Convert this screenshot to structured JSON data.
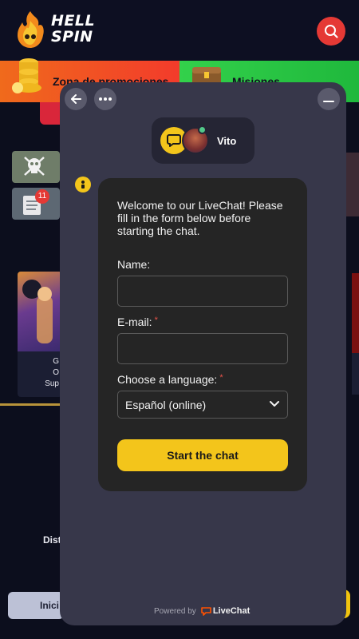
{
  "site": {
    "logo_text_line1": "HELL",
    "logo_text_line2": "SPIN",
    "promo_left_label": "Zona de promociones",
    "promo_right_label": "Misiones",
    "badge_count": "11",
    "game_text_line1": "G",
    "game_text_line2": "O",
    "game_text_line3": "Sup",
    "dist_text": "Dist",
    "nav_button_label": "Inici",
    "colors": {
      "search": "#e53935",
      "promo_left": "#f23b2b",
      "promo_right": "#33d14b",
      "accent_yellow": "#f3c51b"
    }
  },
  "chat": {
    "agent_name": "Vito",
    "welcome": "Welcome to our LiveChat! Please fill in the form below before starting the chat.",
    "name_label": "Name:",
    "name_value": "",
    "email_label": "E-mail:",
    "email_value": "",
    "language_label": "Choose a language:",
    "language_selected": "Español (online)",
    "required_mark": "*",
    "start_button": "Start the chat",
    "powered_by": "Powered by",
    "powered_brand": "LiveChat",
    "icons": [
      "back-arrow-icon",
      "more-options-icon",
      "minimize-icon",
      "chat-bubble-icon",
      "info-icon",
      "chevron-down-icon"
    ]
  }
}
